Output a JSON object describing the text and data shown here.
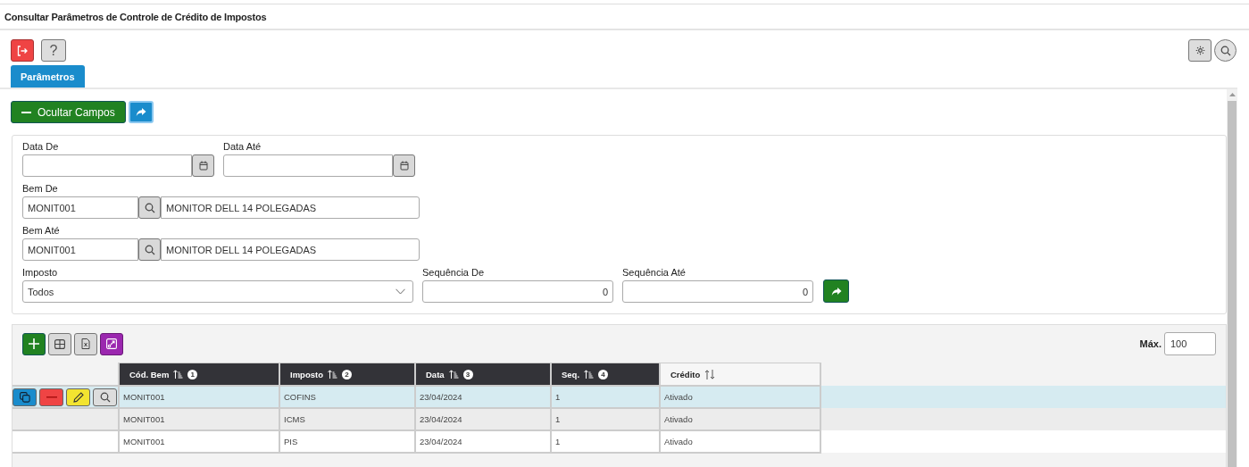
{
  "window": {
    "title": "Consultar Parâmetros de Controle de Crédito de Impostos"
  },
  "help_button": {
    "label": "?"
  },
  "tabs": [
    {
      "label": "Parâmetros",
      "selected": true
    }
  ],
  "toggle_button": {
    "label": "Ocultar Campos"
  },
  "filters": {
    "fields": [
      {
        "kind": "date",
        "label": "Data De"
      },
      {
        "kind": "date",
        "label": "Data Até"
      },
      {
        "kind": "lookup",
        "label": "Bem De",
        "value": "MONIT001",
        "description": "MONITOR DELL 14 POLEGADAS"
      },
      {
        "kind": "lookup",
        "label": "Bem Até",
        "value": "MONIT001",
        "description": "MONITOR DELL 14 POLEGADAS"
      },
      {
        "kind": "select",
        "label": "Imposto",
        "value": "Todos"
      },
      {
        "kind": "number",
        "label": "Sequência De",
        "value": "0"
      },
      {
        "kind": "number",
        "label": "Sequência Até",
        "value": "0"
      }
    ]
  },
  "grid": {
    "max_label": "Máx.",
    "max_value": "100",
    "columns": [
      {
        "label": "Cód. Bem",
        "sorted": true,
        "order": "1"
      },
      {
        "label": "Imposto",
        "sorted": true,
        "order": "2"
      },
      {
        "label": "Data",
        "sorted": true,
        "order": "3"
      },
      {
        "label": "Seq.",
        "sorted": true,
        "order": "4"
      },
      {
        "label": "Crédito",
        "sorted": false
      }
    ],
    "rows": [
      {
        "selected": true,
        "cells": [
          "MONIT001",
          "COFINS",
          "23/04/2024",
          "1",
          "Ativado"
        ]
      },
      {
        "selected": false,
        "cells": [
          "MONIT001",
          "ICMS",
          "23/04/2024",
          "1",
          "Ativado"
        ]
      },
      {
        "selected": false,
        "cells": [
          "MONIT001",
          "PIS",
          "23/04/2024",
          "1",
          "Ativado"
        ]
      }
    ]
  }
}
